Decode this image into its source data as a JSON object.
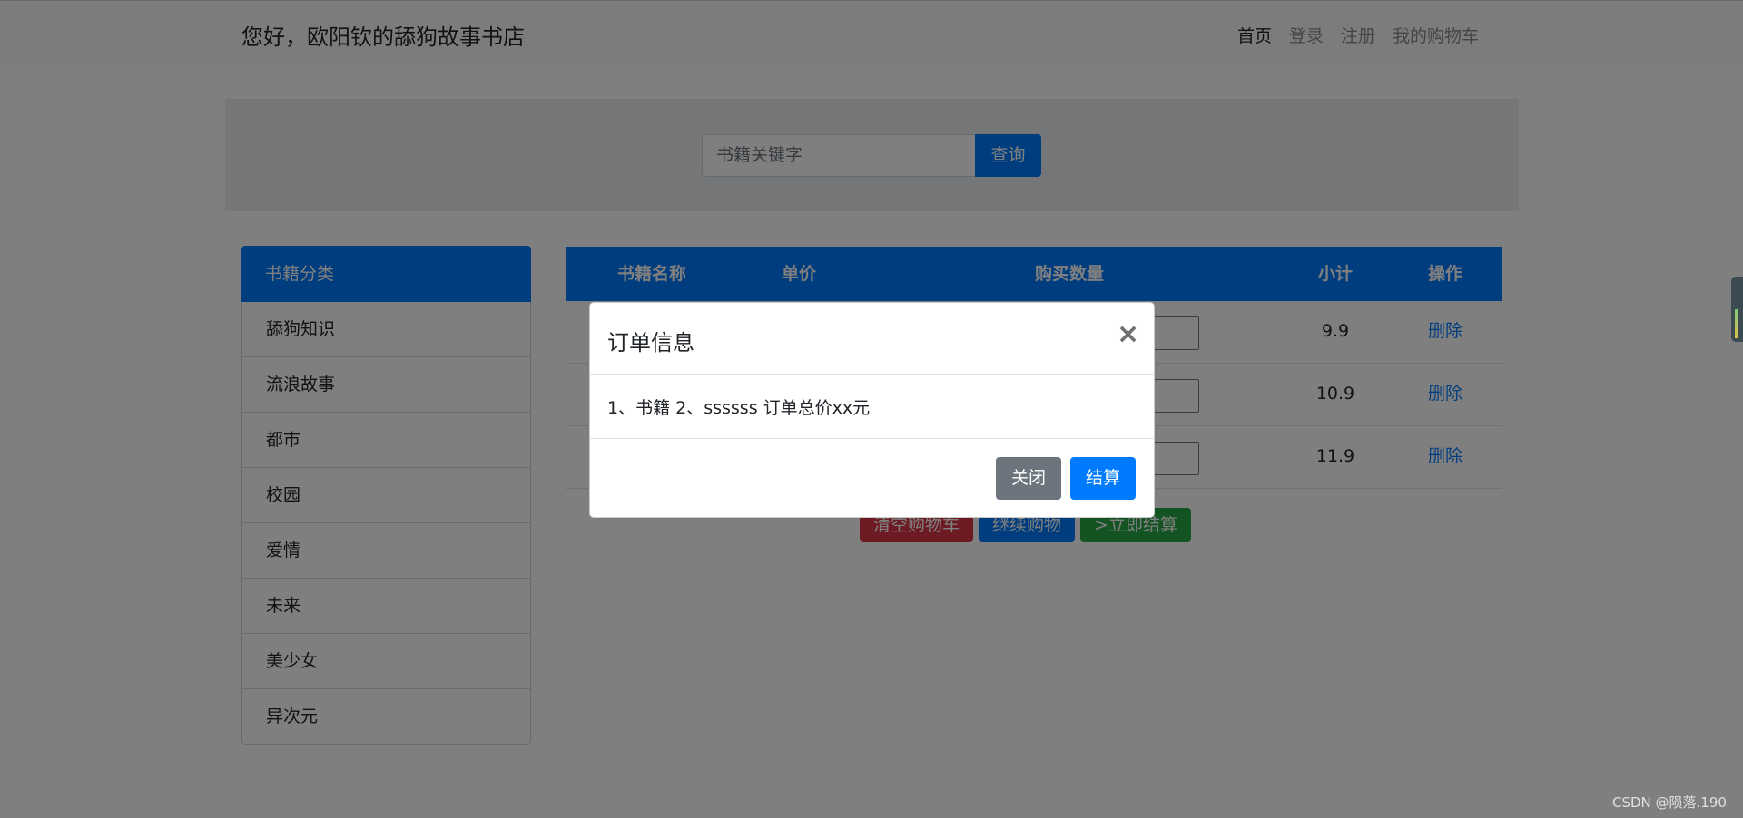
{
  "navbar": {
    "brand": "您好，欧阳钦的舔狗故事书店",
    "links": [
      "首页",
      "登录",
      "注册",
      "我的购物车"
    ]
  },
  "search": {
    "placeholder": "书籍关键字",
    "button": "查询"
  },
  "sidebar": {
    "header": "书籍分类",
    "items": [
      "舔狗知识",
      "流浪故事",
      "都市",
      "校园",
      "爱情",
      "未来",
      "美少女",
      "异次元"
    ]
  },
  "cart": {
    "headers": [
      "书籍名称",
      "单价",
      "购买数量",
      "小计",
      "操作"
    ],
    "rows": [
      {
        "subtotal": "9.9",
        "action": "删除"
      },
      {
        "subtotal": "10.9",
        "action": "删除"
      },
      {
        "subtotal": "11.9",
        "action": "删除"
      }
    ],
    "actions": [
      "清空购物车",
      "继续购物",
      ">立即结算"
    ]
  },
  "modal": {
    "title": "订单信息",
    "close_icon": "×",
    "body": "1、书籍 2、ssssss 订单总价xx元",
    "close_button": "关闭",
    "pay_button": "结算"
  },
  "watermark": "CSDN @陨落.190",
  "colors": {
    "primary": "#007bff",
    "danger": "#dc3545",
    "success": "#28a745",
    "secondary": "#6c757d"
  }
}
